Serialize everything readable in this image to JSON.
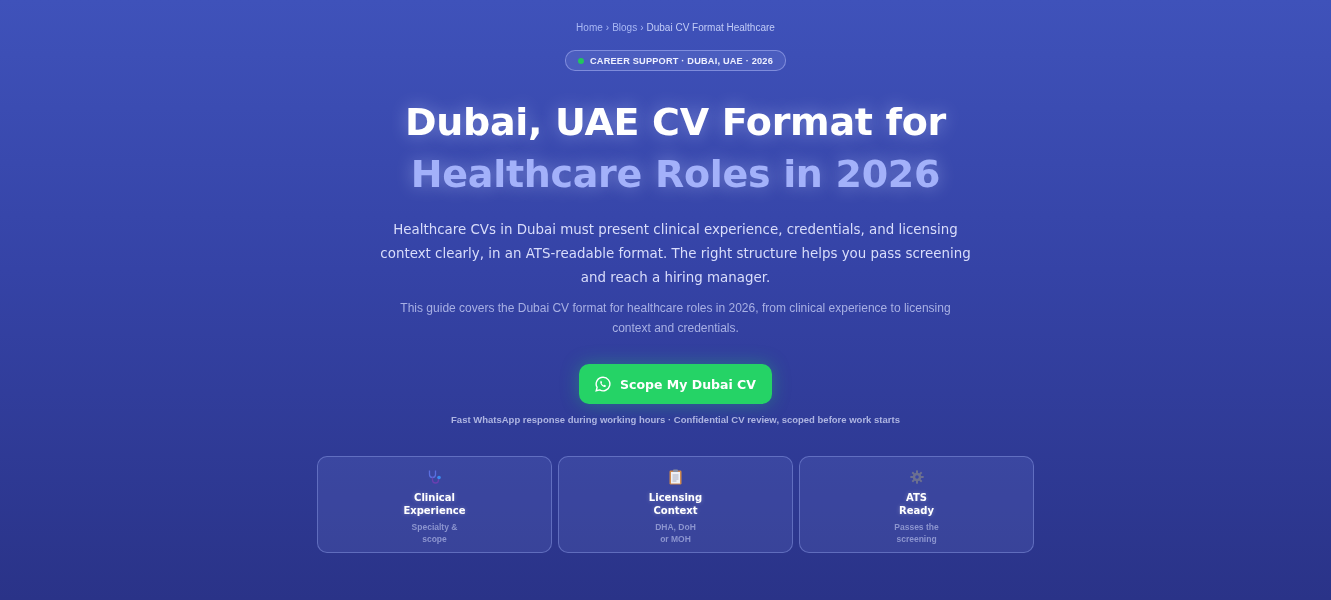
{
  "breadcrumb": [
    {
      "label": "Home",
      "separator": "›"
    },
    {
      "label": "Blogs",
      "separator": "›"
    },
    {
      "label": "Dubai CV Format Healthcare"
    }
  ],
  "badge": {
    "label": "CAREER SUPPORT · DUBAI, UAE · 2026"
  },
  "title": {
    "text": "Dubai, UAE CV Format for",
    "highlight": "Healthcare Roles in 2026"
  },
  "intro": "Healthcare CVs in Dubai must present clinical experience, credentials, and licensing context clearly, in an ATS-readable format. The right structure helps you pass screening and reach a hiring manager.",
  "note": "This guide covers the Dubai CV format for healthcare roles in 2026, from clinical experience to licensing context and credentials.",
  "cta": {
    "label": "Scope My Dubai CV"
  },
  "footnote": "Fast WhatsApp response during working hours · Confidential CV review, scoped before work starts",
  "cards": [
    {
      "kind": "stethoscope",
      "title": "Clinical Experience",
      "subtitle": "Specialty & scope"
    },
    {
      "kind": "clipboard",
      "title": "Licensing Context",
      "subtitle": "DHA, DoH or MOH"
    },
    {
      "kind": "gear",
      "title": "ATS Ready",
      "subtitle": "Passes the screening"
    }
  ]
}
